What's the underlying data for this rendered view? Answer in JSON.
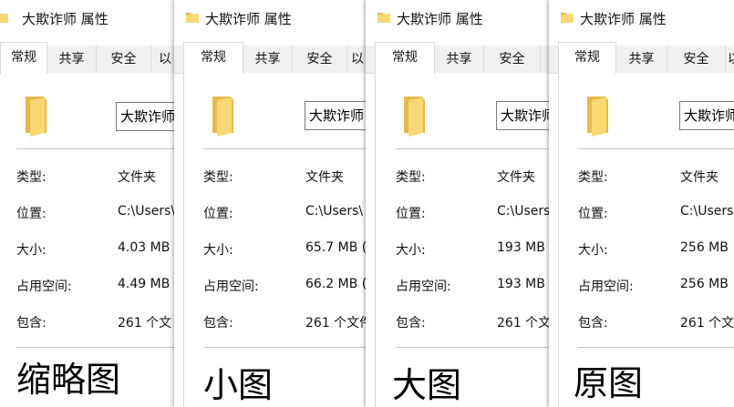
{
  "windows": [
    {
      "title": "大欺诈师 属性",
      "tabs": [
        "常规",
        "共享",
        "安全",
        "以"
      ],
      "folder_name": "大欺诈师",
      "rows": [
        {
          "label": "类型:",
          "value": "文件夹"
        },
        {
          "label": "位置:",
          "value": "C:\\Users\\"
        },
        {
          "label": "大小:",
          "value": "4.03 MB"
        },
        {
          "label": "占用空间:",
          "value": "4.49 MB"
        },
        {
          "label": "包含:",
          "value": "261 个文"
        }
      ],
      "caption": "缩略图"
    },
    {
      "title": "大欺诈师 属性",
      "tabs": [
        "常规",
        "共享",
        "安全",
        "以"
      ],
      "folder_name": "大欺诈师",
      "rows": [
        {
          "label": "类型:",
          "value": "文件夹"
        },
        {
          "label": "位置:",
          "value": "C:\\Users\\"
        },
        {
          "label": "大小:",
          "value": "65.7 MB ("
        },
        {
          "label": "占用空间:",
          "value": "66.2 MB ("
        },
        {
          "label": "包含:",
          "value": "261 个文件"
        }
      ],
      "caption": "小图"
    },
    {
      "title": "大欺诈师 属性",
      "tabs": [
        "常规",
        "共享",
        "安全"
      ],
      "folder_name": "大欺诈师",
      "rows": [
        {
          "label": "类型:",
          "value": "文件夹"
        },
        {
          "label": "位置:",
          "value": "C:\\Users"
        },
        {
          "label": "大小:",
          "value": "193 MB"
        },
        {
          "label": "占用空间:",
          "value": "193 MB"
        },
        {
          "label": "包含:",
          "value": "261 个文"
        }
      ],
      "caption": "大图"
    },
    {
      "title": "大欺诈师 属性",
      "tabs": [
        "常规",
        "共享",
        "安全",
        "以"
      ],
      "folder_name": "大欺诈师",
      "rows": [
        {
          "label": "类型:",
          "value": "文件夹"
        },
        {
          "label": "位置:",
          "value": "C:\\Users"
        },
        {
          "label": "大小:",
          "value": "256 MB"
        },
        {
          "label": "占用空间:",
          "value": "256 MB"
        },
        {
          "label": "包含:",
          "value": "261 个文"
        }
      ],
      "caption": "原图"
    }
  ],
  "colors": {
    "folder_front": "#f8d775",
    "folder_back": "#e8b948",
    "separator": "#c9c9c9",
    "tabstrip": "#f0f0f0"
  },
  "icons": {
    "title_icon": "folder-icon",
    "panel_icon": "folder-icon"
  }
}
